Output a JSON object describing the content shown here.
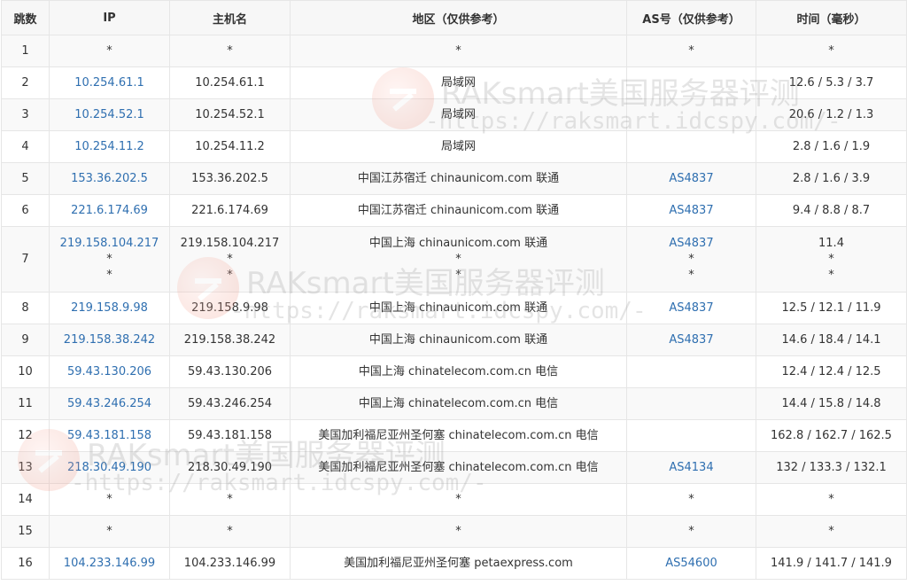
{
  "headers": [
    "跳数",
    "IP",
    "主机名",
    "地区（仅供参考）",
    "AS号（仅供参考）",
    "时间（毫秒）"
  ],
  "rows": [
    {
      "hop": "1",
      "ip": "*",
      "host": "*",
      "region": "*",
      "as": "*",
      "time": "*"
    },
    {
      "hop": "2",
      "ip": "10.254.61.1",
      "host": "10.254.61.1",
      "region": "局域网",
      "as": "",
      "time": "12.6 / 5.3 / 3.7"
    },
    {
      "hop": "3",
      "ip": "10.254.52.1",
      "host": "10.254.52.1",
      "region": "局域网",
      "as": "",
      "time": "20.6 / 1.2 / 1.3"
    },
    {
      "hop": "4",
      "ip": "10.254.11.2",
      "host": "10.254.11.2",
      "region": "局域网",
      "as": "",
      "time": "2.8 / 1.6 / 1.9"
    },
    {
      "hop": "5",
      "ip": "153.36.202.5",
      "host": "153.36.202.5",
      "region": "中国江苏宿迁 chinaunicom.com 联通",
      "as": "AS4837",
      "time": "2.8 / 1.6 / 3.9"
    },
    {
      "hop": "6",
      "ip": "221.6.174.69",
      "host": "221.6.174.69",
      "region": "中国江苏宿迁 chinaunicom.com 联通",
      "as": "AS4837",
      "time": "9.4 / 8.8 / 8.7"
    },
    {
      "hop": "7",
      "ip": "219.158.104.217",
      "ip2": "*",
      "ip3": "*",
      "host": "219.158.104.217",
      "host2": "*",
      "host3": "*",
      "region": "中国上海 chinaunicom.com 联通",
      "region2": "*",
      "region3": "*",
      "as": "AS4837",
      "as2": "*",
      "as3": "*",
      "time": "11.4",
      "time2": "*",
      "time3": "*"
    },
    {
      "hop": "8",
      "ip": "219.158.9.98",
      "host": "219.158.9.98",
      "region": "中国上海 chinaunicom.com 联通",
      "as": "AS4837",
      "time": "12.5 / 12.1 / 11.9"
    },
    {
      "hop": "9",
      "ip": "219.158.38.242",
      "host": "219.158.38.242",
      "region": "中国上海 chinaunicom.com 联通",
      "as": "AS4837",
      "time": "14.6 / 18.4 / 14.1"
    },
    {
      "hop": "10",
      "ip": "59.43.130.206",
      "host": "59.43.130.206",
      "region": "中国上海 chinatelecom.com.cn 电信",
      "as": "",
      "time": "12.4 / 12.4 / 12.5"
    },
    {
      "hop": "11",
      "ip": "59.43.246.254",
      "host": "59.43.246.254",
      "region": "中国上海 chinatelecom.com.cn 电信",
      "as": "",
      "time": "14.4 / 15.8 / 14.8"
    },
    {
      "hop": "12",
      "ip": "59.43.181.158",
      "host": "59.43.181.158",
      "region": "美国加利福尼亚州圣何塞 chinatelecom.com.cn 电信",
      "as": "",
      "time": "162.8 / 162.7 / 162.5"
    },
    {
      "hop": "13",
      "ip": "218.30.49.190",
      "host": "218.30.49.190",
      "region": "美国加利福尼亚州圣何塞 chinatelecom.com.cn 电信",
      "as": "AS4134",
      "time": "132 / 133.3 / 132.1"
    },
    {
      "hop": "14",
      "ip": "*",
      "host": "*",
      "region": "*",
      "as": "*",
      "time": "*"
    },
    {
      "hop": "15",
      "ip": "*",
      "host": "*",
      "region": "*",
      "as": "*",
      "time": "*"
    },
    {
      "hop": "16",
      "ip": "104.233.146.99",
      "host": "104.233.146.99",
      "region": "美国加利福尼亚州圣何塞 petaexpress.com",
      "as": "AS54600",
      "time": "141.9 / 141.7 / 141.9"
    }
  ],
  "watermark": {
    "line1": "RAKsmart美国服务器评测",
    "line2": "-https://raksmart.idcspy.com/-"
  },
  "colors": {
    "link": "#2f6fb0",
    "border": "#e6e6e6",
    "row_alt": "#f9f9f9"
  }
}
